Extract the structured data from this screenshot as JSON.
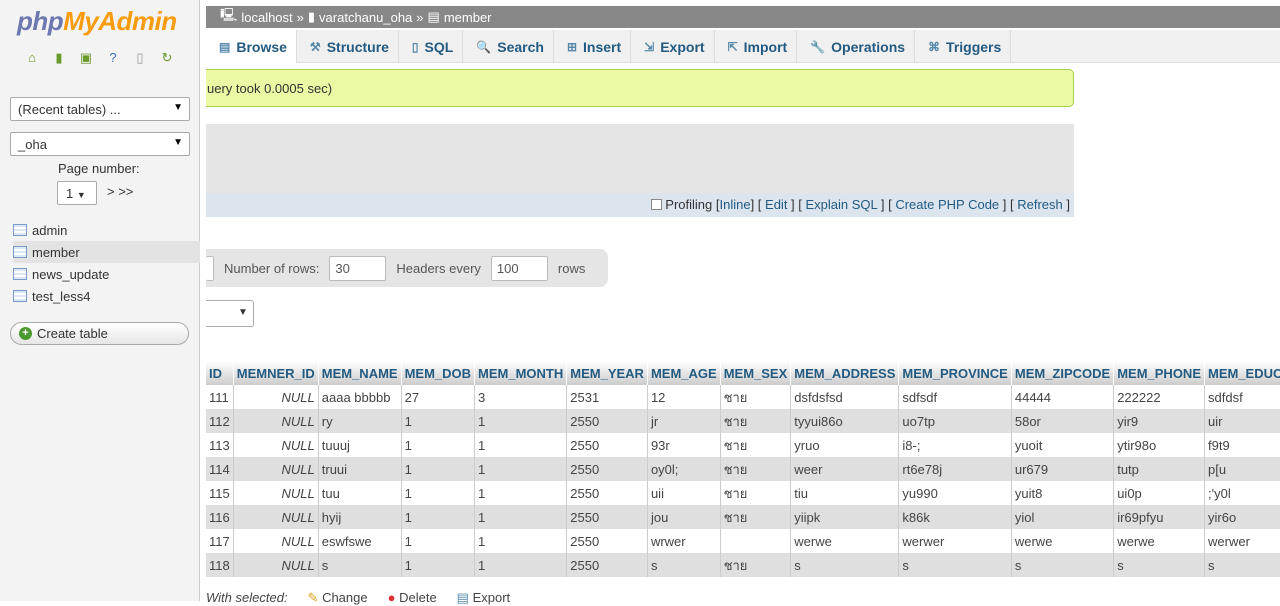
{
  "sidebar": {
    "logo_php": "php",
    "logo_admin": "MyAdmin",
    "recent": "(Recent tables) ...",
    "db": "_oha",
    "page_label": "Page number:",
    "page": "1",
    "page_nav": "> >>",
    "tables": [
      "admin",
      "member",
      "news_update",
      "test_less4"
    ],
    "create": "Create table"
  },
  "breadcrumb": {
    "server": "localhost",
    "db": "varatchanu_oha",
    "table": "member",
    "sep": "»"
  },
  "tabs": [
    {
      "label": "Browse",
      "icon": "▤"
    },
    {
      "label": "Structure",
      "icon": "⚒"
    },
    {
      "label": "SQL",
      "icon": "▯"
    },
    {
      "label": "Search",
      "icon": "🔍"
    },
    {
      "label": "Insert",
      "icon": "⊞"
    },
    {
      "label": "Export",
      "icon": "⇲"
    },
    {
      "label": "Import",
      "icon": "⇱"
    },
    {
      "label": "Operations",
      "icon": "🔧"
    },
    {
      "label": "Triggers",
      "icon": "⌘"
    }
  ],
  "message": "uery took 0.0005 sec)",
  "sqlbar": {
    "profiling": "Profiling",
    "inline": "Inline",
    "edit": "Edit",
    "explain": "Explain SQL",
    "php": "Create PHP Code",
    "refresh": "Refresh"
  },
  "nav": {
    "rows_label": "Number of rows:",
    "rows": "30",
    "headers_label": "Headers every",
    "headers": "100",
    "rows_suffix": "rows"
  },
  "table": {
    "columns": [
      "ID",
      "MEMNER_ID",
      "MEM_NAME",
      "MEM_DOB",
      "MEM_MONTH",
      "MEM_YEAR",
      "MEM_AGE",
      "MEM_SEX",
      "MEM_ADDRESS",
      "MEM_PROVINCE",
      "MEM_ZIPCODE",
      "MEM_PHONE",
      "MEM_EDUCA"
    ],
    "rows": [
      [
        "111",
        "NULL",
        "aaaa bbbbb",
        "27",
        "3",
        "2531",
        "12",
        "ชาย",
        "dsfdsfsd",
        "sdfsdf",
        "44444",
        "222222",
        "sdfdsf"
      ],
      [
        "112",
        "NULL",
        "ry",
        "1",
        "1",
        "2550",
        "jr",
        "ชาย",
        "tyyui86o",
        "uo7tp",
        "58or",
        "yir9",
        "uir"
      ],
      [
        "113",
        "NULL",
        "tuuuj",
        "1",
        "1",
        "2550",
        "93r",
        "ชาย",
        "yruo",
        "i8-;",
        "yuoit",
        "ytir98o",
        "f9t9"
      ],
      [
        "114",
        "NULL",
        "truui",
        "1",
        "1",
        "2550",
        "oy0l;",
        "ชาย",
        "weer",
        "rt6e78j",
        "ur679",
        "tutp",
        "p[u"
      ],
      [
        "115",
        "NULL",
        "tuu",
        "1",
        "1",
        "2550",
        "uii",
        "ชาย",
        "tiu",
        "yu990",
        "yuit8",
        "ui0p",
        ";'y0l"
      ],
      [
        "116",
        "NULL",
        "hyij",
        "1",
        "1",
        "2550",
        "jou",
        "ชาย",
        "yiipk",
        "k86k",
        "yiol",
        "ir69pfyu",
        "yir6o"
      ],
      [
        "117",
        "NULL",
        "eswfswe",
        "1",
        "1",
        "2550",
        "wrwer",
        "",
        "werwe",
        "werwer",
        "werwe",
        "werwe",
        "werwer"
      ],
      [
        "118",
        "NULL",
        "s",
        "1",
        "1",
        "2550",
        "s",
        "ชาย",
        "s",
        "s",
        "s",
        "s",
        "s"
      ]
    ]
  },
  "with_selected": {
    "label": "With selected:",
    "change": "Change",
    "delete": "Delete",
    "export": "Export"
  }
}
